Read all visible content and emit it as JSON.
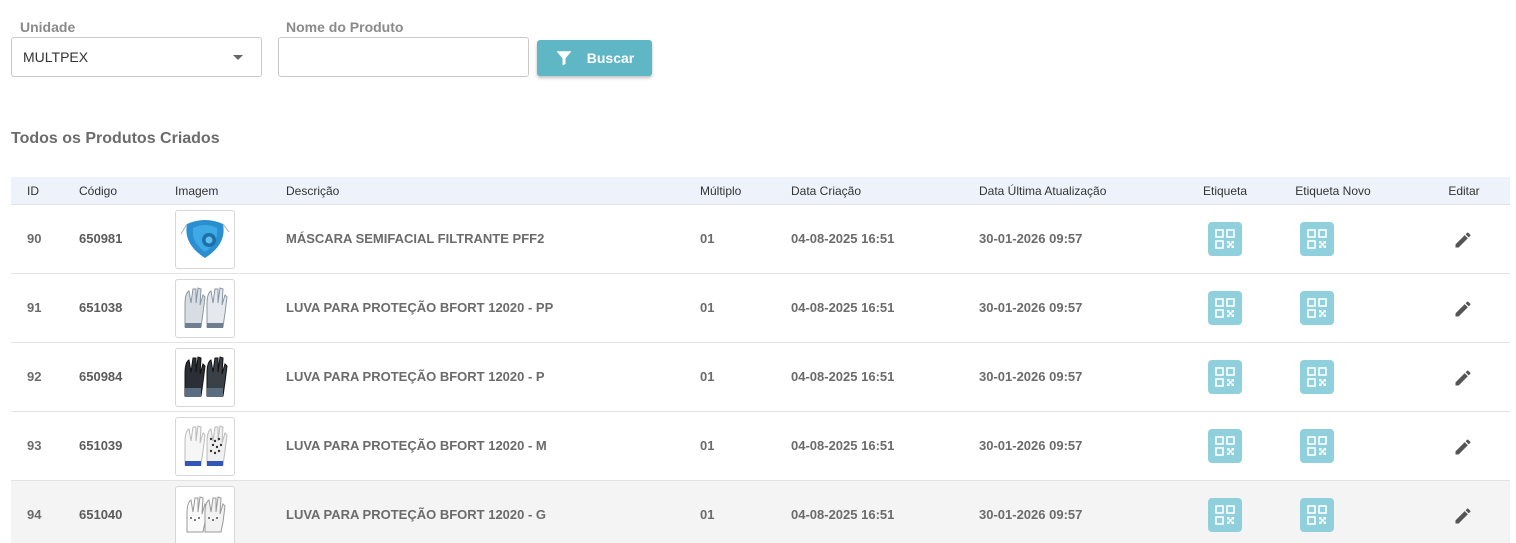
{
  "filters": {
    "unit_label": "Unidade",
    "unit_value": "MULTPEX",
    "product_label": "Nome do Produto",
    "product_value": "",
    "product_placeholder": "",
    "search_label": "Buscar"
  },
  "section_title": "Todos os Produtos Criados",
  "table": {
    "headers": {
      "id": "ID",
      "code": "Código",
      "image": "Imagem",
      "description": "Descrição",
      "multiple": "Múltiplo",
      "created": "Data Criação",
      "updated": "Data Última Atualização",
      "label": "Etiqueta",
      "label_new": "Etiqueta Novo",
      "edit": "Editar"
    },
    "rows": [
      {
        "id": "90",
        "code": "650981",
        "image": "mask-image",
        "description": "MÁSCARA SEMIFACIAL FILTRANTE PFF2",
        "multiple": "01",
        "created": "04-08-2025 16:51",
        "updated": "30-01-2026 09:57"
      },
      {
        "id": "91",
        "code": "651038",
        "image": "glove-gray-image",
        "description": "LUVA PARA PROTEÇÃO BFORT 12020 - PP",
        "multiple": "01",
        "created": "04-08-2025 16:51",
        "updated": "30-01-2026 09:57"
      },
      {
        "id": "92",
        "code": "650984",
        "image": "glove-black-image",
        "description": "LUVA PARA PROTEÇÃO BFORT 12020 - P",
        "multiple": "01",
        "created": "04-08-2025 16:51",
        "updated": "30-01-2026 09:57"
      },
      {
        "id": "93",
        "code": "651039",
        "image": "glove-dotted-image",
        "description": "LUVA PARA PROTEÇÃO BFORT 12020 - M",
        "multiple": "01",
        "created": "04-08-2025 16:51",
        "updated": "30-01-2026 09:57"
      },
      {
        "id": "94",
        "code": "651040",
        "image": "glove-white-image",
        "description": "LUVA PARA PROTEÇÃO BFORT 12020 - G",
        "multiple": "01",
        "created": "04-08-2025 16:51",
        "updated": "30-01-2026 09:57"
      }
    ]
  },
  "colors": {
    "accent": "#5fb7c6",
    "qr_button": "#8fd0dc",
    "header_bg": "#eef3fb"
  }
}
